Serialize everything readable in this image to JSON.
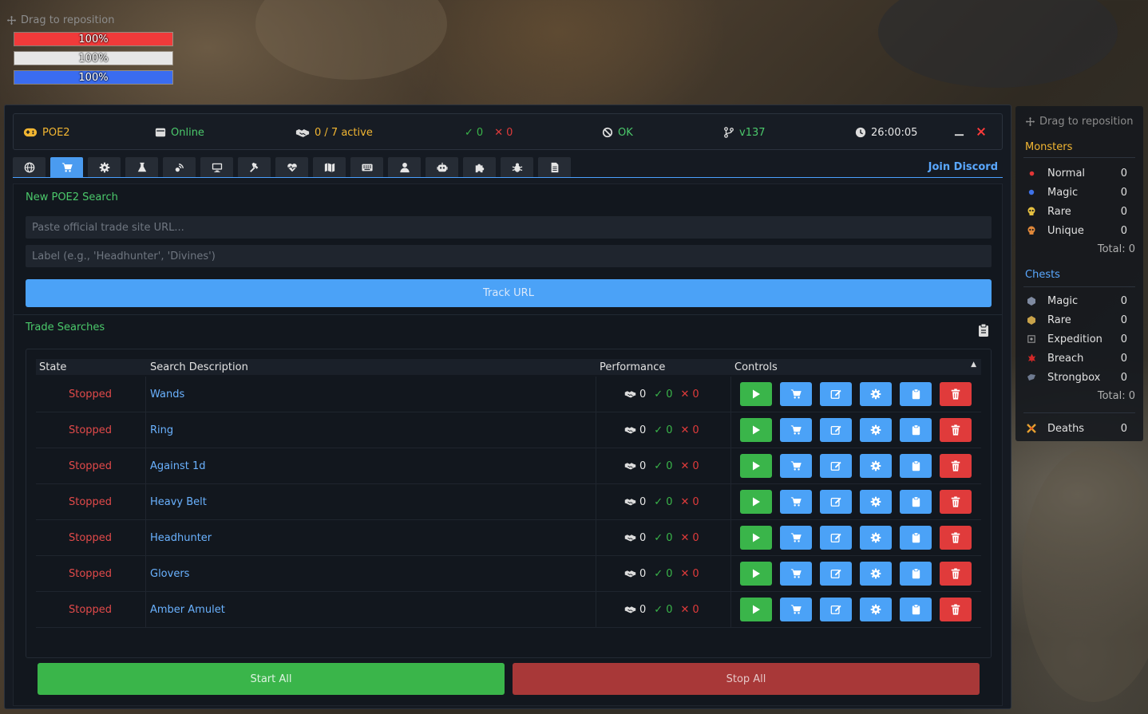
{
  "top_left_overlay": {
    "drag_label": "Drag to reposition",
    "bars": [
      {
        "label": "100%",
        "fill": 1.0,
        "color": "#f03a3a",
        "bg": "#f03a3a"
      },
      {
        "label": "100%",
        "fill": 1.0,
        "color": "#e6e6e6",
        "bg": "#e6e6e6"
      },
      {
        "label": "100%",
        "fill": 1.0,
        "color": "#3a6cf0",
        "bg": "#3a6cf0"
      }
    ]
  },
  "status": {
    "game": "POE2",
    "connection": "Online",
    "active": "0 / 7 active",
    "success_count": "0",
    "fail_count": "0",
    "health": "OK",
    "version": "v137",
    "timer": "26:00:05"
  },
  "tabs": {
    "icons": [
      "globe-icon",
      "cart-icon",
      "gear-icon",
      "flask-icon",
      "satellite-icon",
      "monitor-icon",
      "hammer-icon",
      "heart-pulse-icon",
      "map-icon",
      "keyboard-icon",
      "user-icon",
      "robot-icon",
      "puzzle-icon",
      "bug-icon",
      "file-icon"
    ],
    "active_index": 1,
    "join_discord": "Join Discord"
  },
  "new_search": {
    "title": "New POE2 Search",
    "url_placeholder": "Paste official trade site URL...",
    "label_placeholder": "Label (e.g., 'Headhunter', 'Divines')",
    "track_button": "Track URL"
  },
  "trade_searches": {
    "title": "Trade Searches",
    "columns": [
      "State",
      "Search Description",
      "Performance",
      "Controls"
    ],
    "rows": [
      {
        "state": "Stopped",
        "description": "Wands",
        "trades": "0",
        "ok": "0",
        "fail": "0"
      },
      {
        "state": "Stopped",
        "description": "Ring",
        "trades": "0",
        "ok": "0",
        "fail": "0"
      },
      {
        "state": "Stopped",
        "description": "Against 1d",
        "trades": "0",
        "ok": "0",
        "fail": "0"
      },
      {
        "state": "Stopped",
        "description": "Heavy Belt",
        "trades": "0",
        "ok": "0",
        "fail": "0"
      },
      {
        "state": "Stopped",
        "description": "Headhunter",
        "trades": "0",
        "ok": "0",
        "fail": "0"
      },
      {
        "state": "Stopped",
        "description": "Glovers",
        "trades": "0",
        "ok": "0",
        "fail": "0"
      },
      {
        "state": "Stopped",
        "description": "Amber Amulet",
        "trades": "0",
        "ok": "0",
        "fail": "0"
      }
    ],
    "start_all": "Start All",
    "stop_all": "Stop All"
  },
  "right_overlay": {
    "drag_label": "Drag to reposition",
    "monsters": {
      "title": "Monsters",
      "items": [
        {
          "label": "Normal",
          "value": "0",
          "icon": "red-dot-icon"
        },
        {
          "label": "Magic",
          "value": "0",
          "icon": "blue-dot-icon"
        },
        {
          "label": "Rare",
          "value": "0",
          "icon": "yellow-skull-icon"
        },
        {
          "label": "Unique",
          "value": "0",
          "icon": "orange-skull-icon"
        }
      ],
      "total": "Total: 0"
    },
    "chests": {
      "title": "Chests",
      "items": [
        {
          "label": "Magic",
          "value": "0",
          "icon": "magic-chest-icon"
        },
        {
          "label": "Rare",
          "value": "0",
          "icon": "rare-chest-icon"
        },
        {
          "label": "Expedition",
          "value": "0",
          "icon": "expedition-chest-icon"
        },
        {
          "label": "Breach",
          "value": "0",
          "icon": "breach-chest-icon"
        },
        {
          "label": "Strongbox",
          "value": "0",
          "icon": "strongbox-icon"
        }
      ],
      "total": "Total: 0"
    },
    "deaths": {
      "label": "Deaths",
      "value": "0"
    }
  },
  "colors": {
    "accent_blue": "#4ba2f7",
    "success_green": "#3ab54a",
    "danger_red": "#e03b3b",
    "status_yellow": "#f2b632",
    "link_blue": "#6ab2ff",
    "section_green": "#4bc96b",
    "monsters_title": "#f2b632",
    "chests_title": "#5aa8ff"
  }
}
